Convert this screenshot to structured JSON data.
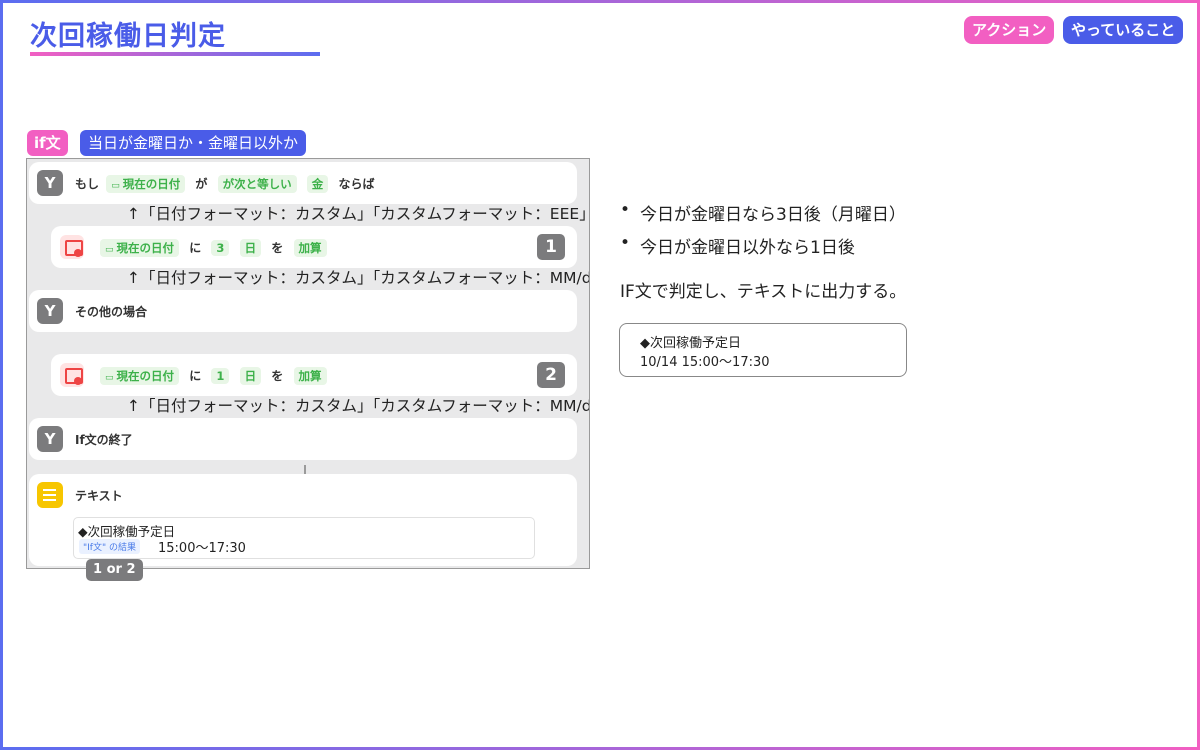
{
  "header": {
    "title": "次回稼働日判定",
    "tag_action": "アクション",
    "tag_doing": "やっていること"
  },
  "if_section": {
    "if_tag": "if文",
    "condition_tag": "当日が金曜日か・金曜日以外か"
  },
  "shortcut": {
    "if_row": {
      "prefix": "もし",
      "var": "現在の日付",
      "ga": "が",
      "op": "が次と等しい",
      "value": "金",
      "suffix": "ならば"
    },
    "annot_eee": "↑「日付フォーマット：カスタム」「カスタムフォーマット：EEE」",
    "add3_row": {
      "var": "現在の日付",
      "ni": "に",
      "amount": "3",
      "unit": "日",
      "wo": "を",
      "action": "加算",
      "badge": "1"
    },
    "annot_mmdd_1": "↑「日付フォーマット：カスタム」「カスタムフォーマット：MM/dd」",
    "else_label": "その他の場合",
    "add1_row": {
      "var": "現在の日付",
      "ni": "に",
      "amount": "1",
      "unit": "日",
      "wo": "を",
      "action": "加算",
      "badge": "2"
    },
    "annot_mmdd_2": "↑「日付フォーマット：カスタム」「カスタムフォーマット：MM/dd」",
    "endif_label": "If文の終了",
    "text_action": {
      "label": "テキスト",
      "line1": "◆次回稼働予定日",
      "var": "\"If文\" の結果",
      "time": "15:00〜17:30"
    },
    "one_or_two": "1 or 2"
  },
  "explanation": {
    "bullets": [
      "今日が金曜日なら3日後（月曜日）",
      "今日が金曜日以外なら1日後"
    ],
    "summary": "IF文で判定し、テキストに出力する。",
    "result_line1": "◆次回稼働予定日",
    "result_line2": "10/14 15:00〜17:30"
  },
  "colors": {
    "accent_blue": "#4a5ce8",
    "accent_pink": "#f25fc2",
    "pill_green": "#3db14a"
  },
  "icons": {
    "if": "branch-icon",
    "calendar": "calendar-add-icon",
    "text": "text-lines-icon"
  }
}
